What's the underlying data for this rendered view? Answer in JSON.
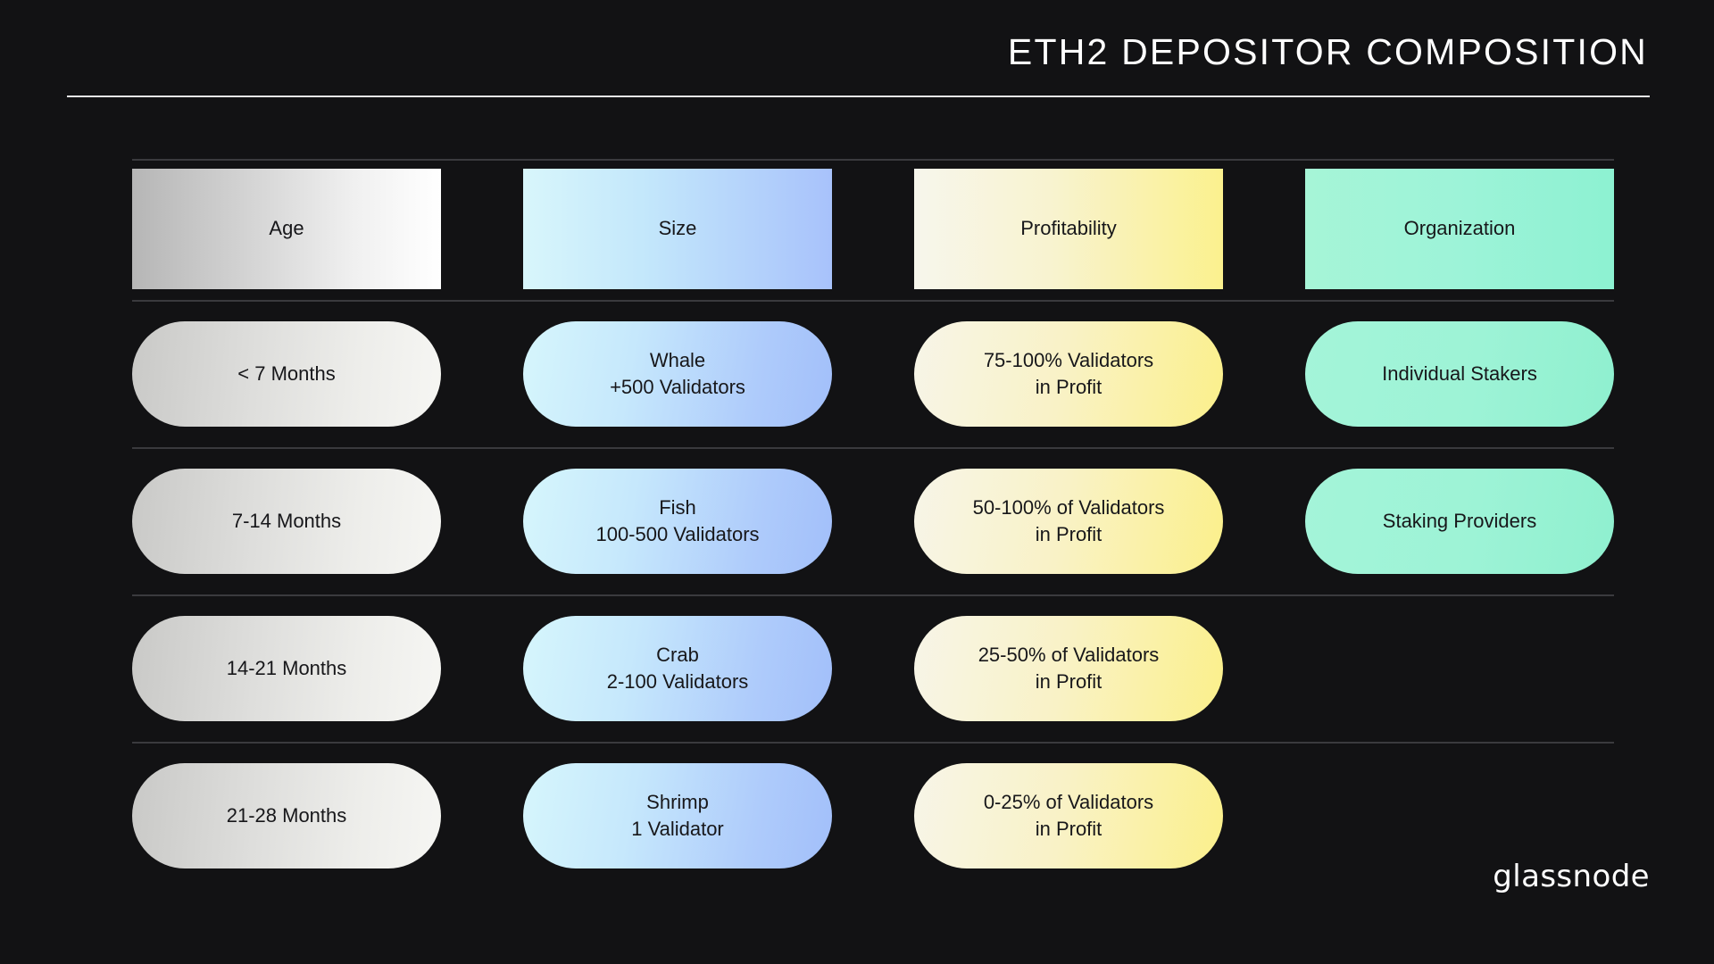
{
  "header": {
    "title": "ETH2 DEPOSITOR COMPOSITION"
  },
  "brand": {
    "name": "glassnode"
  },
  "colors": {
    "background": "#121214",
    "title_text": "#ffffff",
    "rule": "#3a3a3e",
    "cell_text": "#17171a",
    "age_start": "#b6b6b6",
    "age_end": "#ffffff",
    "size_start": "#d8f6fb",
    "size_end": "#a8c2fb",
    "profit_start": "#f7f6ec",
    "profit_end": "#fbf18e",
    "org_start": "#a6f5d7",
    "org_end": "#8df2d2"
  },
  "columns": [
    {
      "key": "age",
      "label": "Age"
    },
    {
      "key": "size",
      "label": "Size"
    },
    {
      "key": "profit",
      "label": "Profitability"
    },
    {
      "key": "org",
      "label": "Organization"
    }
  ],
  "rows": [
    {
      "age": {
        "lines": [
          "< 7 Months"
        ]
      },
      "size": {
        "lines": [
          "Whale",
          "+500 Validators"
        ]
      },
      "profit": {
        "lines": [
          "75-100% Validators",
          "in Profit"
        ]
      },
      "org": {
        "lines": [
          "Individual Stakers"
        ]
      }
    },
    {
      "age": {
        "lines": [
          "7-14 Months"
        ]
      },
      "size": {
        "lines": [
          "Fish",
          "100-500 Validators"
        ]
      },
      "profit": {
        "lines": [
          "50-100% of Validators",
          "in Profit"
        ]
      },
      "org": {
        "lines": [
          "Staking Providers"
        ]
      }
    },
    {
      "age": {
        "lines": [
          "14-21 Months"
        ]
      },
      "size": {
        "lines": [
          "Crab",
          "2-100 Validators"
        ]
      },
      "profit": {
        "lines": [
          "25-50% of Validators",
          "in Profit"
        ]
      },
      "org": {
        "lines": []
      }
    },
    {
      "age": {
        "lines": [
          "21-28 Months"
        ]
      },
      "size": {
        "lines": [
          "Shrimp",
          "1 Validator"
        ]
      },
      "profit": {
        "lines": [
          "0-25% of Validators",
          "in Profit"
        ]
      },
      "org": {
        "lines": []
      }
    }
  ]
}
